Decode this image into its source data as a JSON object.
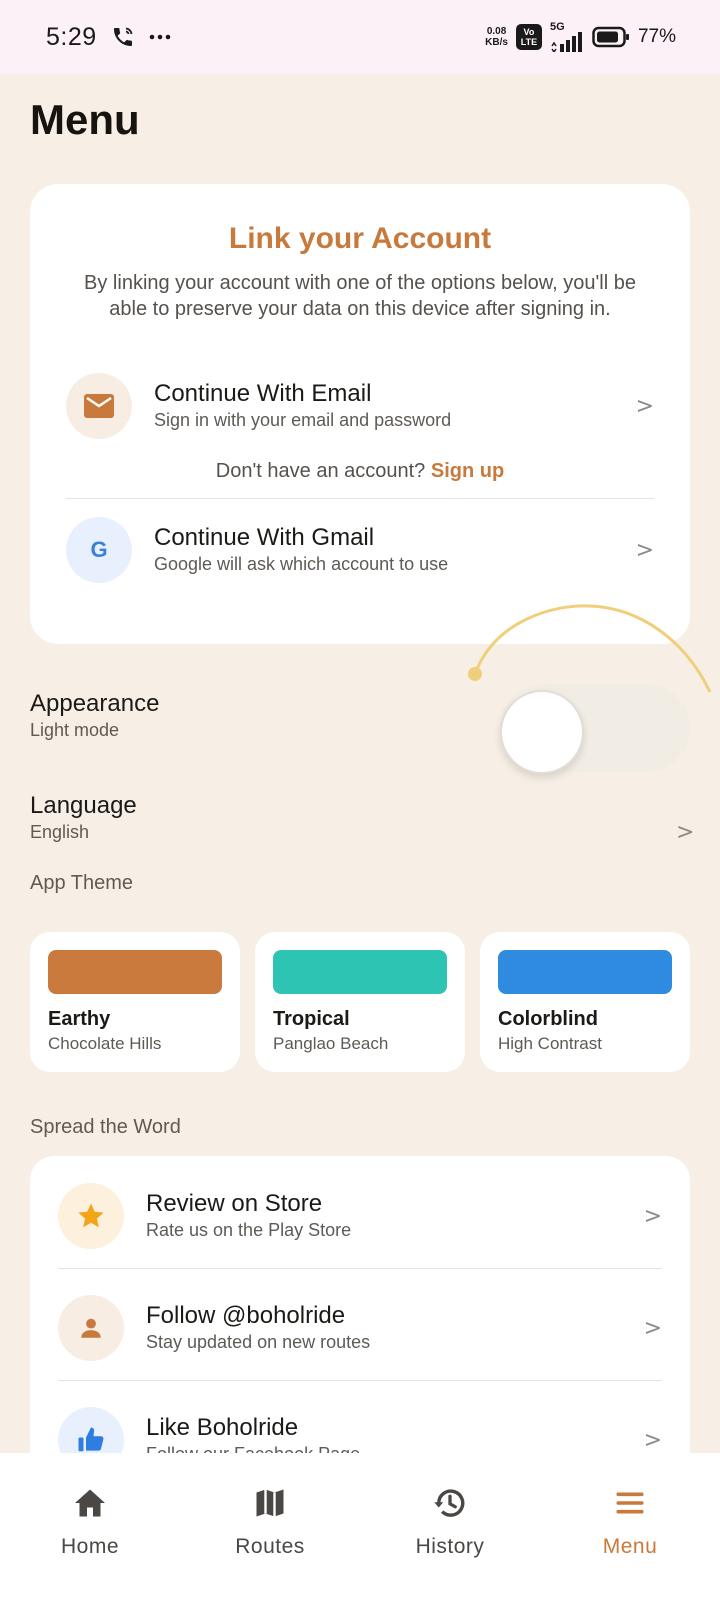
{
  "status_bar": {
    "time": "5:29",
    "speed_value": "0.08",
    "speed_unit": "KB/s",
    "volte_top": "Vo",
    "volte_bottom": "LTE",
    "network": "5G",
    "battery_pct": "77%",
    "icons": [
      "phone-wifi-call-icon",
      "more-dots-icon",
      "signal-icon",
      "battery-icon"
    ]
  },
  "page": {
    "title": "Menu"
  },
  "link_account": {
    "title": "Link your Account",
    "description": "By linking your account with one of the options below, you'll be able to preserve your data on this device after signing in.",
    "email": {
      "title": "Continue With Email",
      "subtitle": "Sign in with your email and password",
      "icon": "mail-icon"
    },
    "signup_prompt": "Don't have an account?",
    "signup_link": "Sign up",
    "gmail": {
      "title": "Continue With Gmail",
      "subtitle": "Google will ask which account to use",
      "icon_letter": "G"
    },
    "chevron": ">"
  },
  "appearance": {
    "title": "Appearance",
    "value": "Light mode",
    "toggle_on": false
  },
  "language": {
    "title": "Language",
    "value": "English",
    "chevron": ">"
  },
  "app_theme": {
    "label": "App Theme",
    "themes": [
      {
        "name": "Earthy",
        "subtitle": "Chocolate Hills",
        "color": "#c97a3c"
      },
      {
        "name": "Tropical",
        "subtitle": "Panglao Beach",
        "color": "#2ec4b3"
      },
      {
        "name": "Colorblind",
        "subtitle": "High Contrast",
        "color": "#2e8be0"
      }
    ]
  },
  "spread": {
    "label": "Spread the Word",
    "items": [
      {
        "title": "Review on Store",
        "subtitle": "Rate us on the Play Store",
        "icon": "star-icon"
      },
      {
        "title": "Follow @boholride",
        "subtitle": "Stay updated on new routes",
        "icon": "person-icon"
      },
      {
        "title": "Like Boholride",
        "subtitle": "Follow our Facebook Page",
        "icon": "thumbs-up-icon"
      }
    ],
    "chevron": ">"
  },
  "nav": {
    "items": [
      {
        "label": "Home",
        "icon": "home-icon"
      },
      {
        "label": "Routes",
        "icon": "map-icon"
      },
      {
        "label": "History",
        "icon": "history-icon"
      },
      {
        "label": "Menu",
        "icon": "menu-icon",
        "active": true
      }
    ]
  },
  "colors": {
    "accent": "#c77a3c",
    "background": "#f7efe5",
    "card": "#ffffff"
  }
}
